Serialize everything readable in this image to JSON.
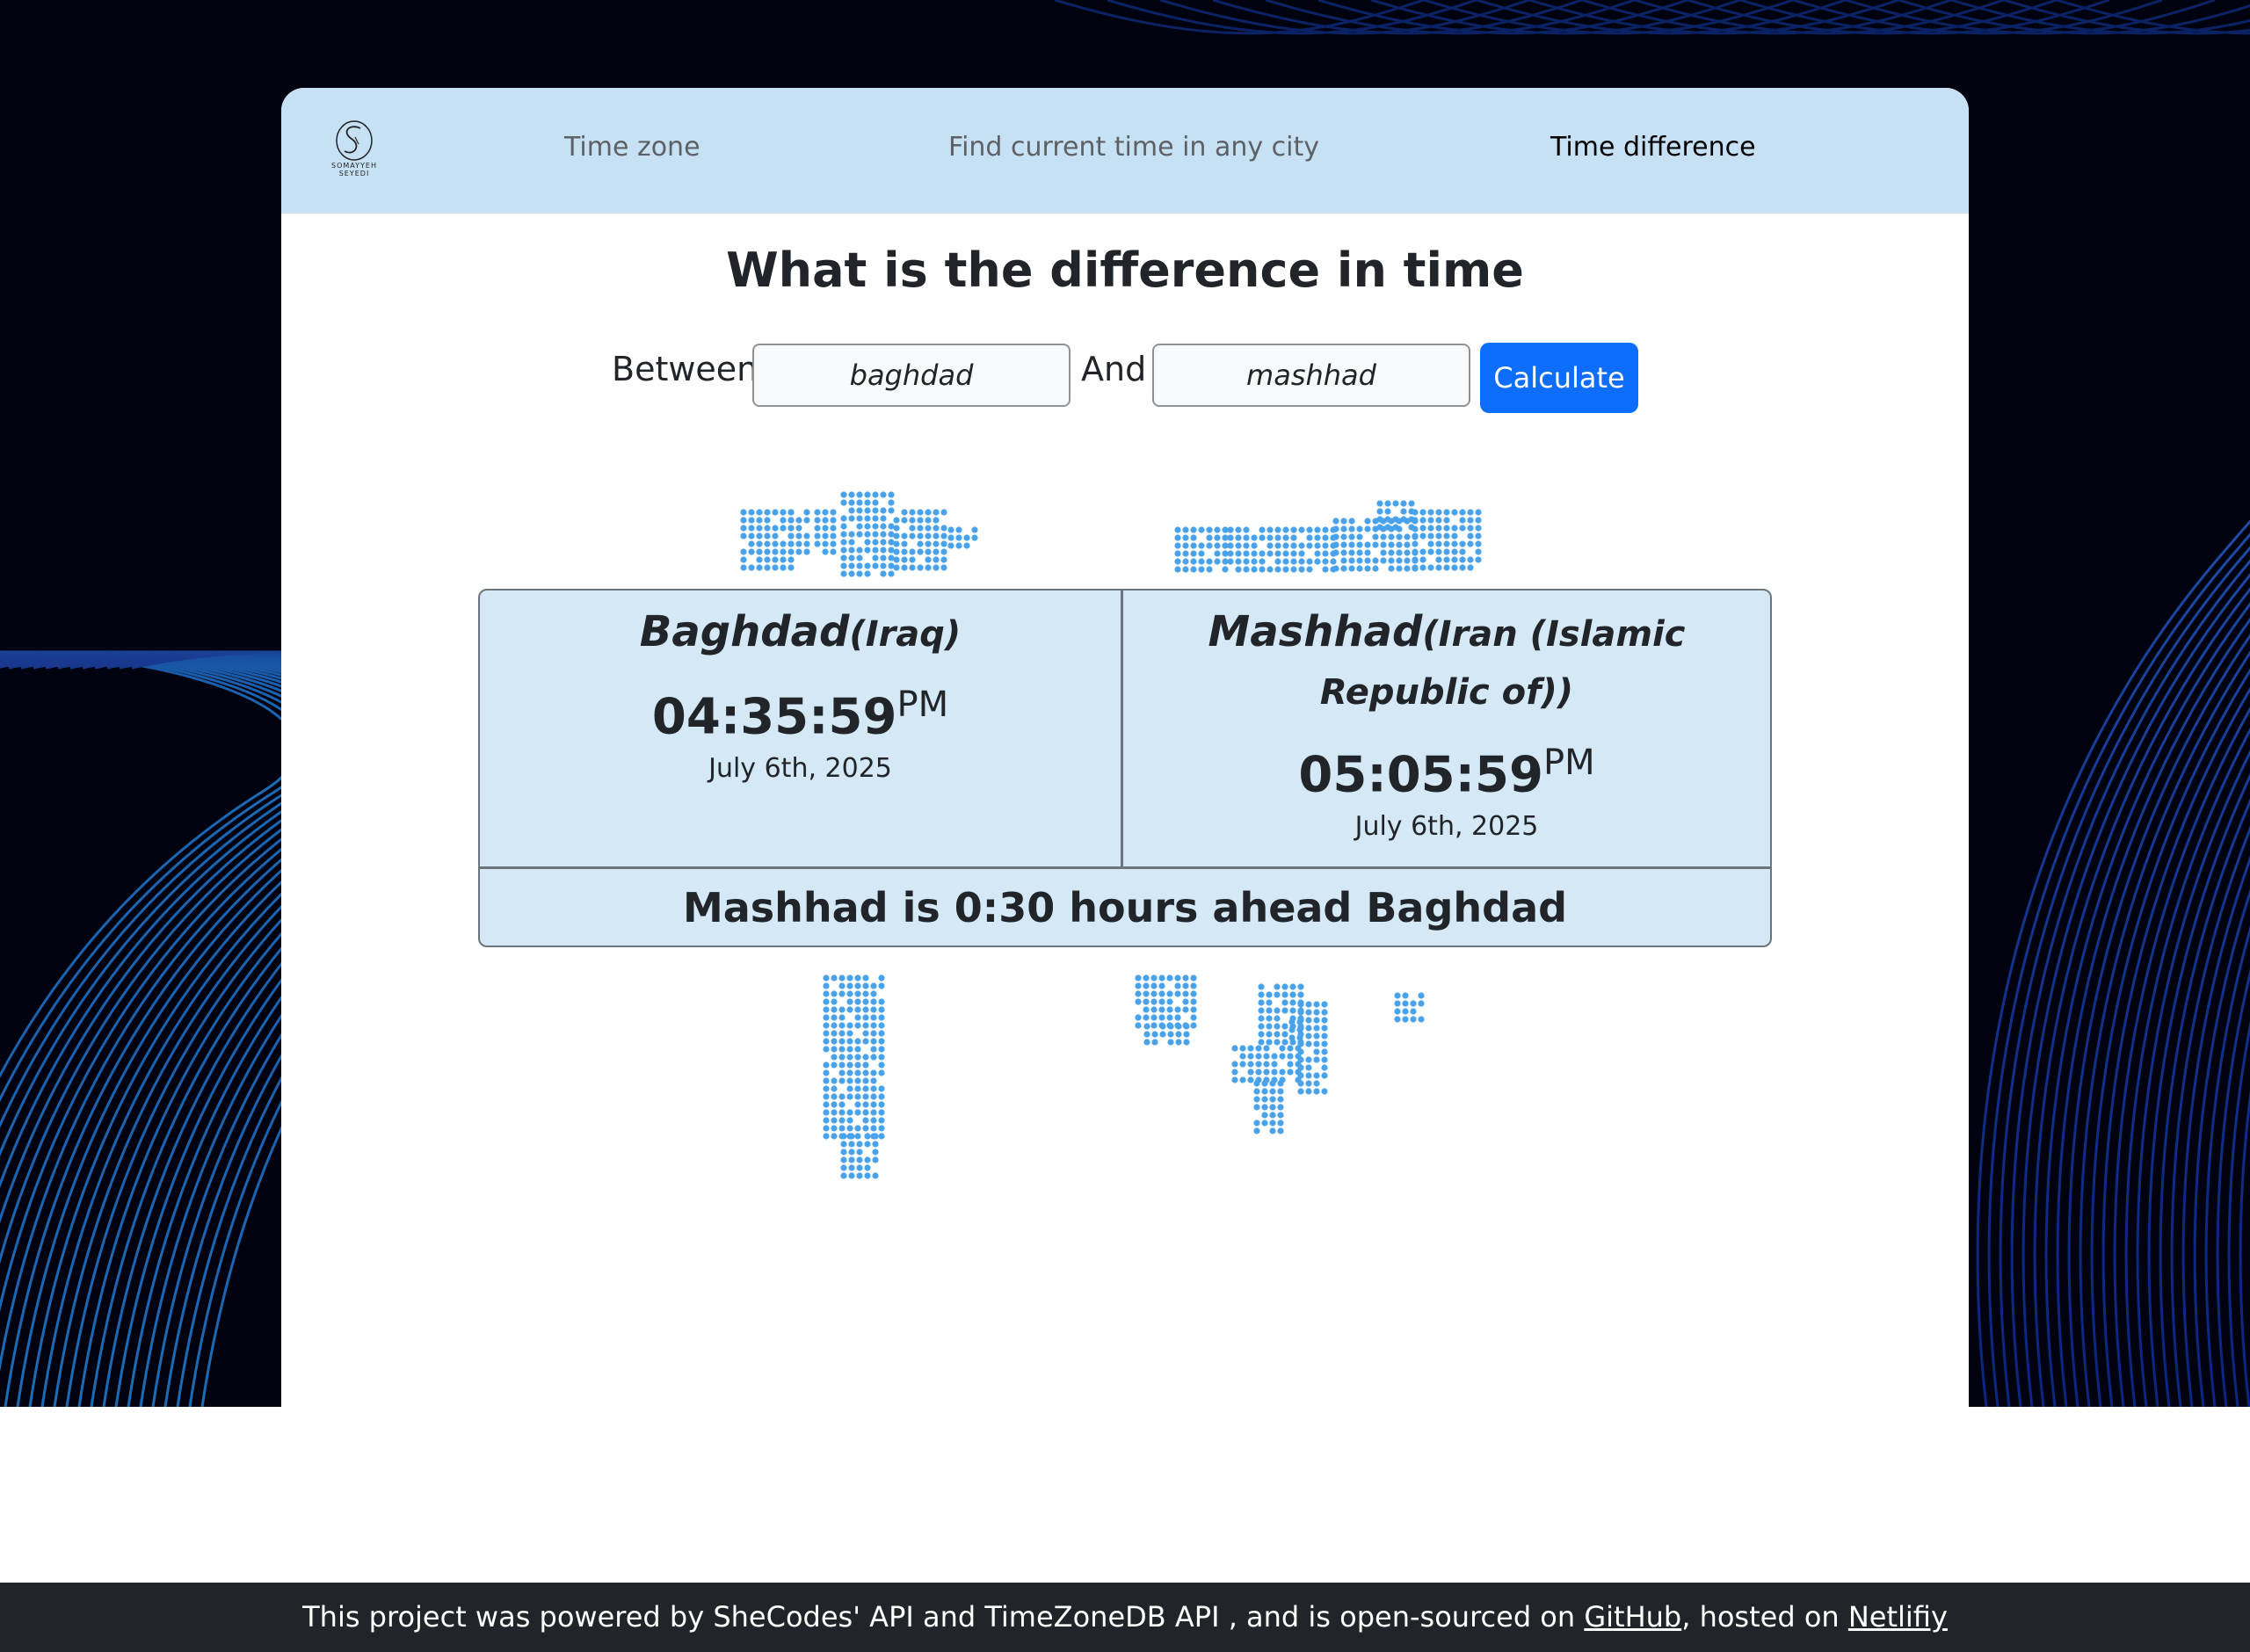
{
  "nav": {
    "logo_text": "SOMAYYEH SEYEDI",
    "links": [
      "Time zone",
      "Find current time in any city",
      "Time difference"
    ],
    "active_index": 2
  },
  "main": {
    "title": "What is the difference in time",
    "between_label": "Between",
    "and_label": "And",
    "city1_value": "baghdad",
    "city2_value": "mashhad",
    "calculate_label": "Calculate"
  },
  "result": {
    "city1": {
      "name": "Baghdad",
      "country": "(Iraq)",
      "time": "04:35:59",
      "ampm": "PM",
      "date": "July 6th, 2025"
    },
    "city2": {
      "name": "Mashhad",
      "country": "(Iran (Islamic Republic of))",
      "time": "05:05:59",
      "ampm": "PM",
      "date": "July 6th, 2025"
    },
    "difference": "Mashhad is 0:30 hours ahead Baghdad"
  },
  "footer": {
    "text_before": "This project was powered by SheCodes' API and TimeZoneDB API , and is open-sourced on ",
    "github_link": "GitHub",
    "text_middle": ", hosted on ",
    "netlify_link": "Netlifiy"
  },
  "colors": {
    "nav_bg": "#c7e1f4",
    "result_bg": "#d4e8f6",
    "button": "#0d6efd",
    "map_dots": "#4aa3ea",
    "footer_bg": "#212529"
  }
}
